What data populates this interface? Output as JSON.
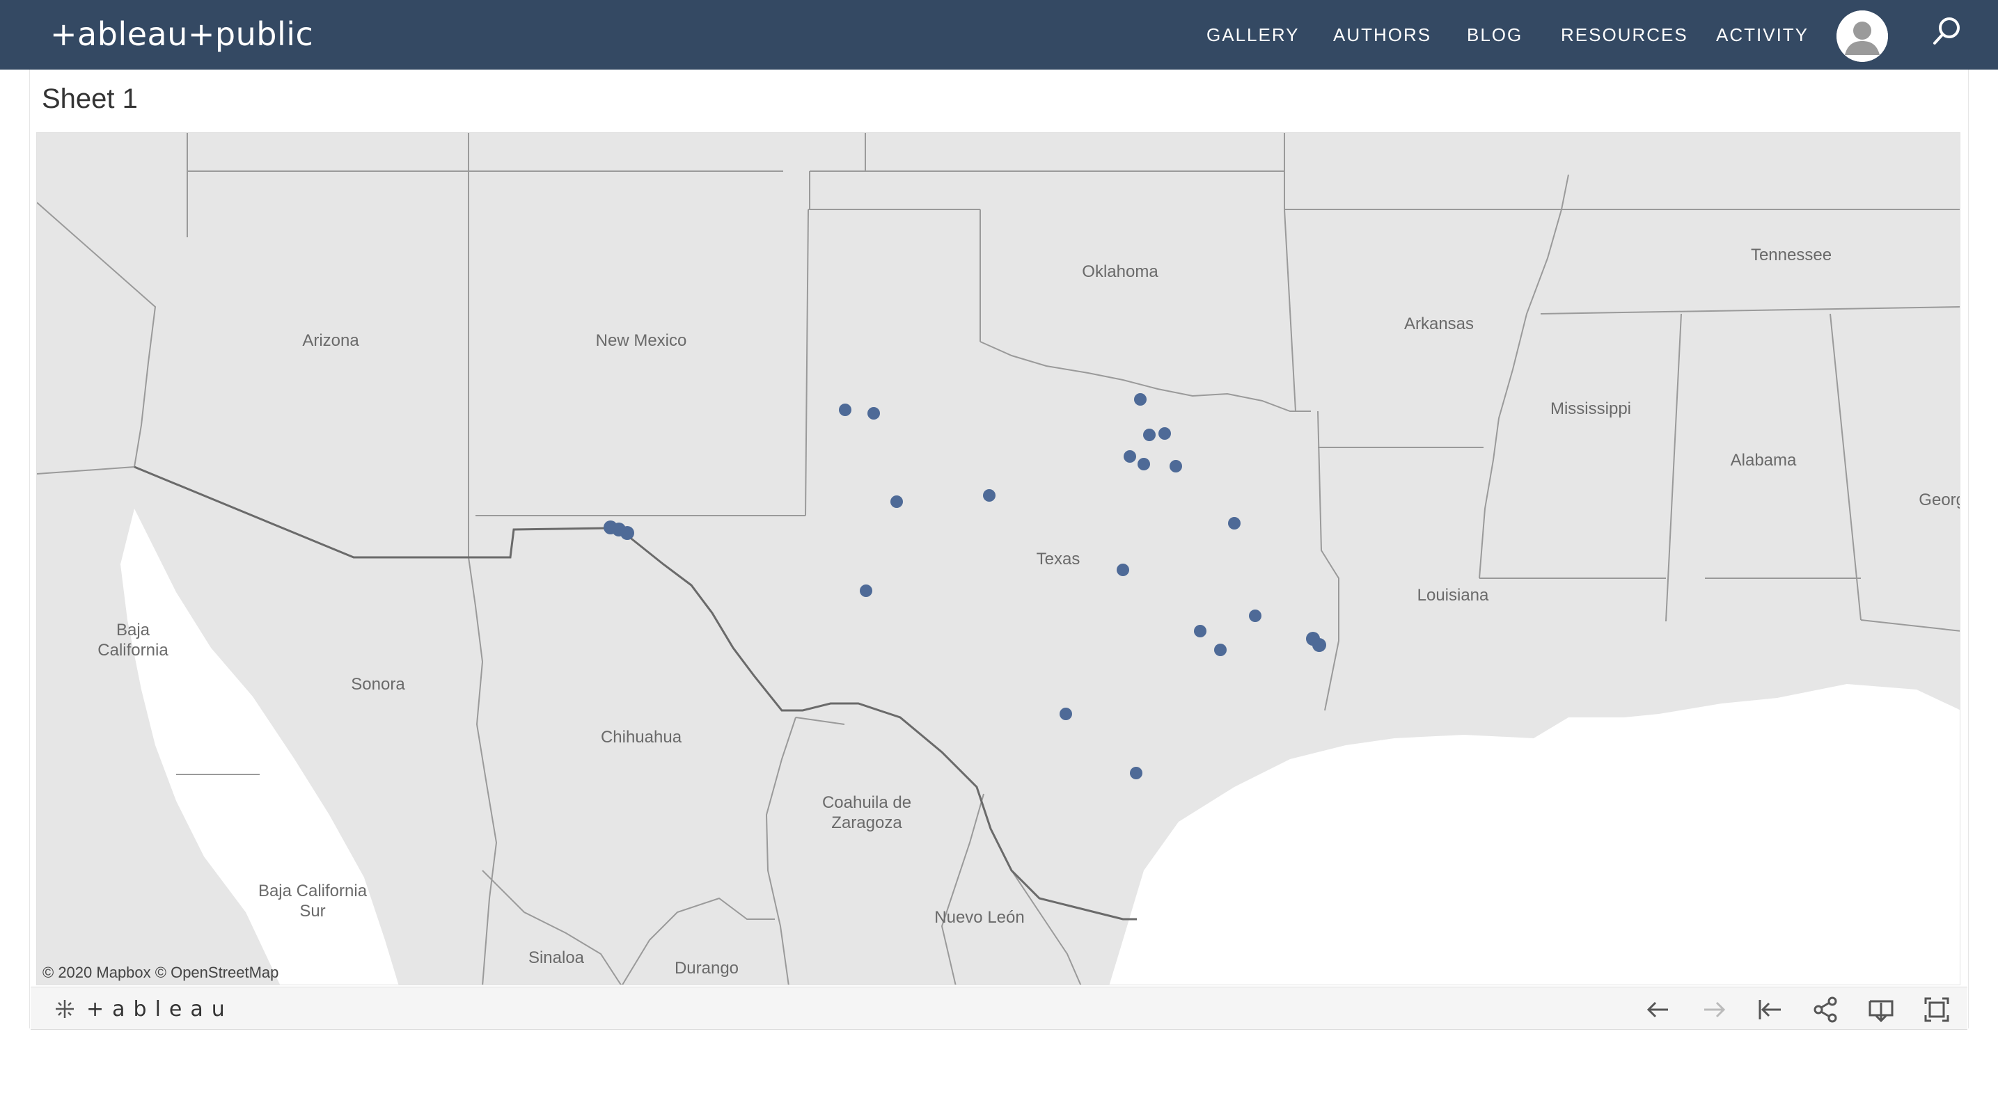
{
  "header": {
    "logo_text": "+ableau+public",
    "nav": [
      "GALLERY",
      "AUTHORS",
      "BLOG",
      "RESOURCES",
      "ACTIVITY"
    ]
  },
  "sheet": {
    "title": "Sheet 1"
  },
  "map": {
    "attribution": "© 2020 Mapbox  © OpenStreetMap",
    "marker_color": "#4e6a97",
    "labels": {
      "arizona": "Arizona",
      "new_mexico": "New Mexico",
      "oklahoma": "Oklahoma",
      "arkansas": "Arkansas",
      "tennessee": "Tennessee",
      "mississippi": "Mississippi",
      "alabama": "Alabama",
      "georgia": "Georgia",
      "louisiana": "Louisiana",
      "texas": "Texas",
      "baja_california": [
        "Baja",
        "California"
      ],
      "sonora": "Sonora",
      "chihuahua": "Chihuahua",
      "coahuila": [
        "Coahuila de",
        "Zaragoza"
      ],
      "nuevo_leon": "Nuevo León",
      "baja_california_sur": [
        "Baja California",
        "Sur"
      ],
      "sinaloa": "Sinaloa",
      "durango": "Durango"
    }
  },
  "toolbar": {
    "logo_text": "+ableau",
    "buttons": [
      "undo-icon",
      "redo-icon",
      "revert-icon",
      "share-icon",
      "download-icon",
      "fullscreen-icon"
    ]
  }
}
